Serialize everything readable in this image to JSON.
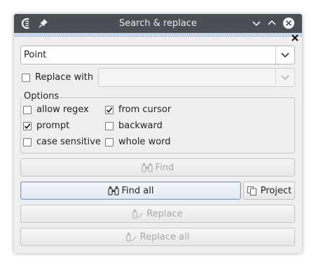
{
  "window": {
    "title": "Search & replace"
  },
  "search": {
    "value": "Point"
  },
  "replace": {
    "label": "Replace with",
    "checked": false,
    "value": ""
  },
  "options": {
    "title": "Options",
    "allow_regex": {
      "label": "allow regex",
      "checked": false
    },
    "from_cursor": {
      "label": "from cursor",
      "checked": true
    },
    "prompt": {
      "label": "prompt",
      "checked": true
    },
    "backward": {
      "label": "backward",
      "checked": false
    },
    "case_sensitive": {
      "label": "case sensitive",
      "checked": false
    },
    "whole_word": {
      "label": "whole word",
      "checked": false
    }
  },
  "buttons": {
    "find": "Find",
    "find_all": "Find all",
    "project": "Project",
    "replace": "Replace",
    "replace_all": "Replace all"
  },
  "colors": {
    "titlebar": "#4b4f55",
    "accent": "#7f9fc6"
  },
  "icons": [
    "app-logo-icon",
    "pin-icon",
    "minimize-icon",
    "maximize-icon",
    "close-icon",
    "binoculars-icon",
    "copy-icon",
    "replace-icon"
  ]
}
